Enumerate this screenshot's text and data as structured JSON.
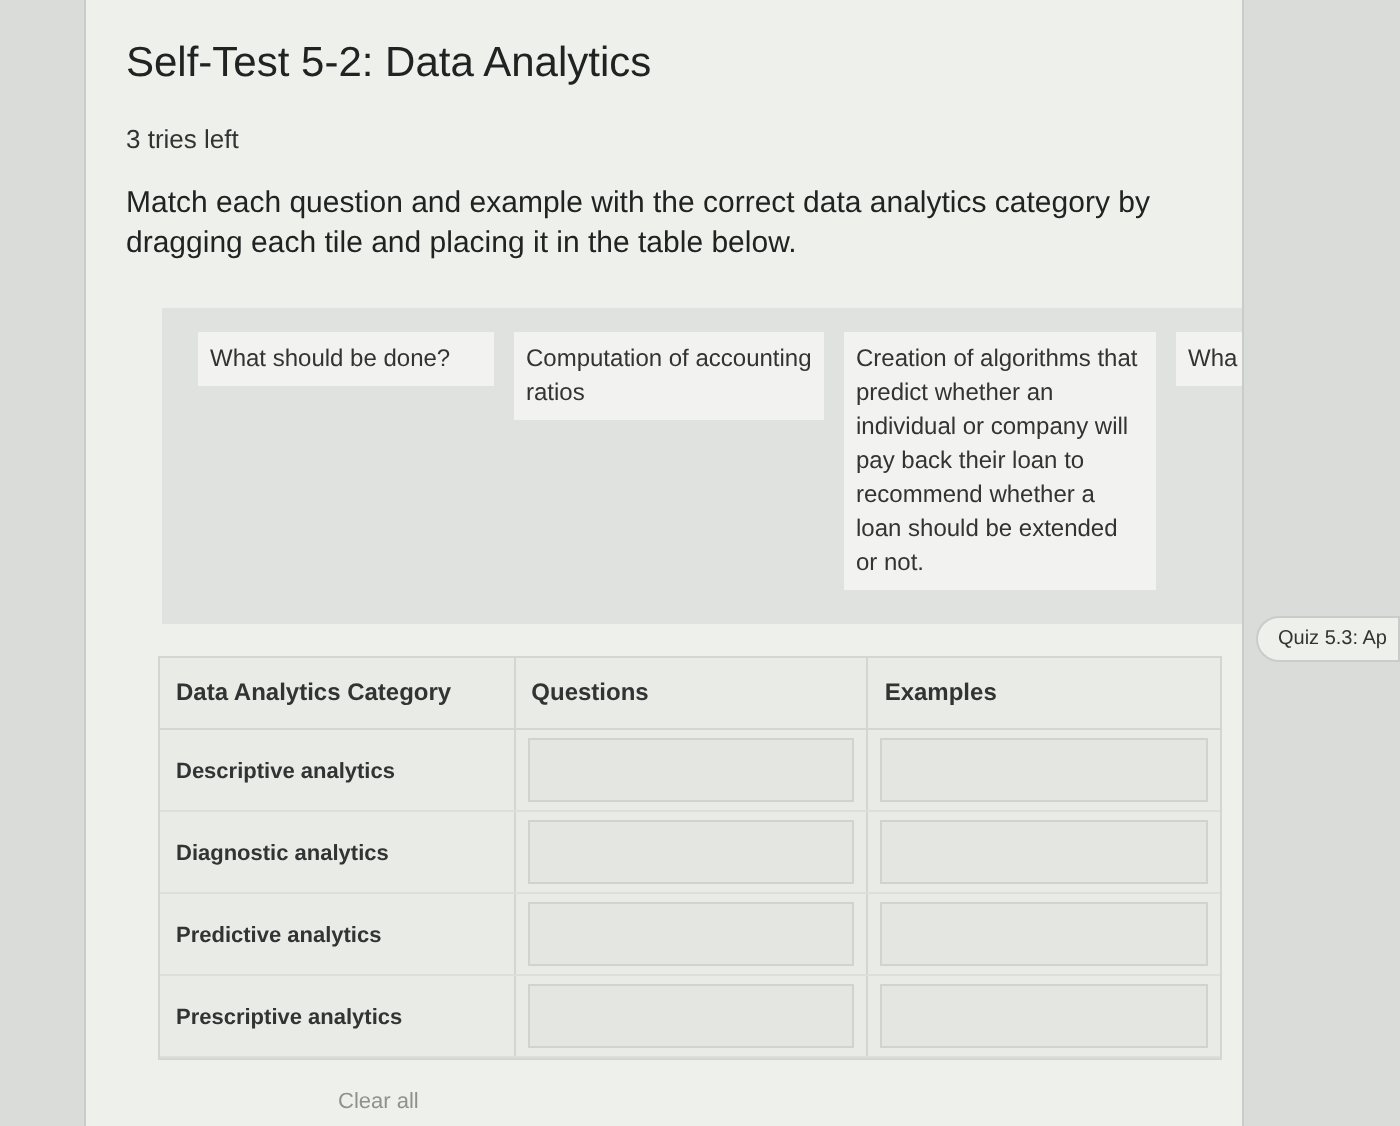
{
  "title": "Self-Test 5-2: Data Analytics",
  "tries": "3 tries left",
  "instructions": "Match each question and example with the correct data analytics category by dragging each tile and placing it in the table below.",
  "tiles": [
    {
      "text": "What should be done?"
    },
    {
      "text": "Computation of accounting ratios"
    },
    {
      "text": "Creation of algorithms that predict whether an individual or company will pay back their loan to recommend whether a loan should be extended or not."
    },
    {
      "text": "Wha"
    }
  ],
  "table": {
    "columns": [
      "Data Analytics Category",
      "Questions",
      "Examples"
    ],
    "rows": [
      {
        "category": "Descriptive analytics"
      },
      {
        "category": "Diagnostic analytics"
      },
      {
        "category": "Predictive analytics"
      },
      {
        "category": "Prescriptive analytics"
      }
    ]
  },
  "clear_button": {
    "label": "Clear all",
    "disabled": true
  },
  "side_tab": {
    "label": "Quiz 5.3: Ap"
  }
}
